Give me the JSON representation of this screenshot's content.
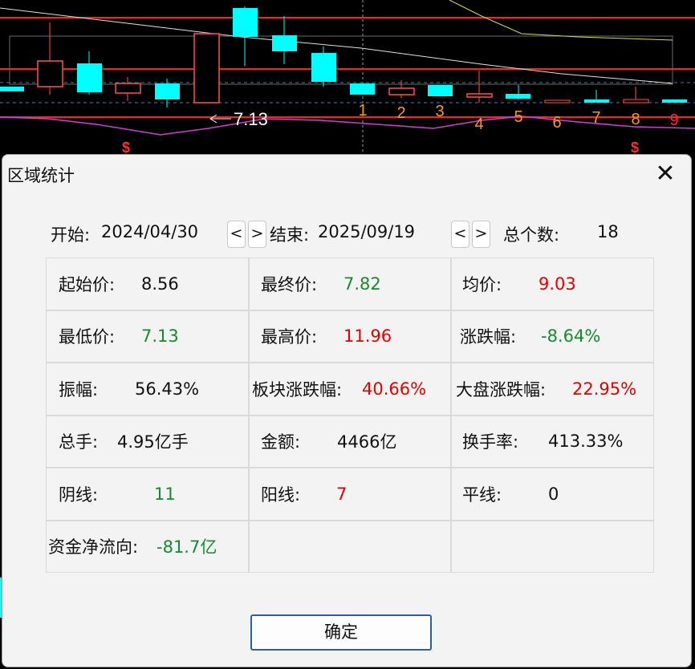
{
  "chart_bg": {
    "price_label": "7.13",
    "markers": [
      "1",
      "2",
      "3",
      "4",
      "5",
      "6",
      "7",
      "8",
      "9"
    ],
    "colors": {
      "bull": "#ff3b3b",
      "bear": "#00ffff",
      "marker": "#ff9a1a",
      "line": "#d0d0d0",
      "ma": "#c8c830",
      "purple": "#cc33cc"
    }
  },
  "dialog": {
    "title": "区域统计",
    "close_icon": "close-icon",
    "start_label": "开始:",
    "start_date": "2024/04/30",
    "end_label": "结束:",
    "end_date": "2025/09/19",
    "prev": "<",
    "next": ">",
    "count_label": "总个数:",
    "count": "18",
    "stats": [
      {
        "label": "起始价:",
        "value": "8.56",
        "color": "black"
      },
      {
        "label": "最终价:",
        "value": "7.82",
        "color": "green"
      },
      {
        "label": "均价:",
        "value": "9.03",
        "color": "red"
      },
      {
        "label": "最低价:",
        "value": "7.13",
        "color": "green"
      },
      {
        "label": "最高价:",
        "value": "11.96",
        "color": "red"
      },
      {
        "label": "涨跌幅:",
        "value": "-8.64%",
        "color": "green"
      },
      {
        "label": "振幅:",
        "value": "56.43%",
        "color": "black"
      },
      {
        "label": "板块涨跌幅:",
        "value": "40.66%",
        "color": "red"
      },
      {
        "label": "大盘涨跌幅:",
        "value": "22.95%",
        "color": "red"
      },
      {
        "label": "总手:",
        "value": "4.95亿手",
        "color": "black"
      },
      {
        "label": "金额:",
        "value": "4466亿",
        "color": "black"
      },
      {
        "label": "换手率:",
        "value": "413.33%",
        "color": "black"
      },
      {
        "label": "阴线:",
        "value": "11",
        "color": "green"
      },
      {
        "label": "阳线:",
        "value": "7",
        "color": "red"
      },
      {
        "label": "平线:",
        "value": "0",
        "color": "black"
      },
      {
        "label": "资金净流向:",
        "value": "-81.7亿",
        "color": "green"
      },
      {
        "label": "",
        "value": "",
        "color": "black"
      },
      {
        "label": "",
        "value": "",
        "color": "black"
      }
    ],
    "ok_label": "确定"
  }
}
